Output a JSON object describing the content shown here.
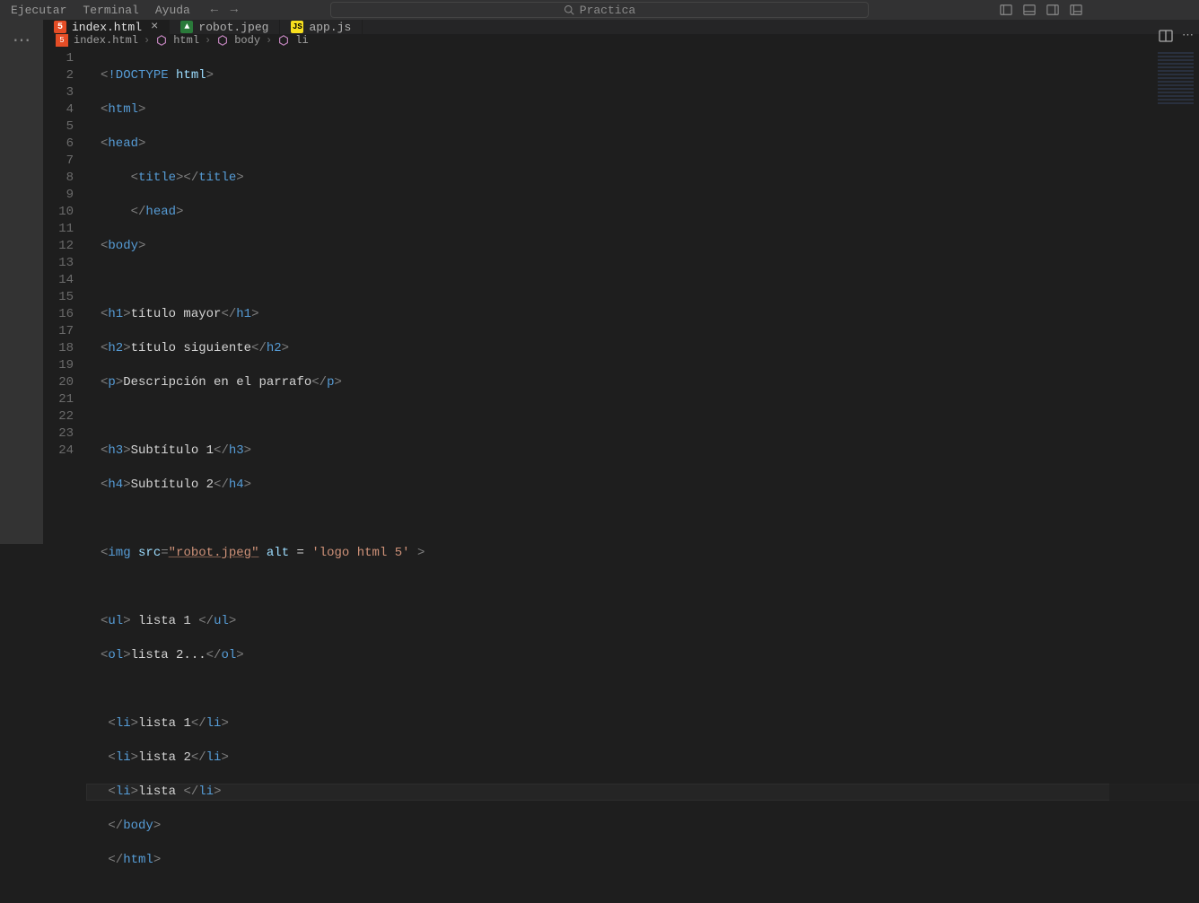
{
  "menu": {
    "run": "Ejecutar",
    "terminal": "Terminal",
    "help": "Ayuda"
  },
  "search": {
    "placeholder": "Practica"
  },
  "tabs": [
    {
      "label": "index.html"
    },
    {
      "label": "robot.jpeg"
    },
    {
      "label": "app.js"
    }
  ],
  "breadcrumbs": {
    "file": "index.html",
    "b1": "html",
    "b2": "body",
    "b3": "li"
  },
  "code": {
    "lines": [
      {
        "n": "1"
      },
      {
        "n": "2"
      },
      {
        "n": "3"
      },
      {
        "n": "4"
      },
      {
        "n": "5"
      },
      {
        "n": "6"
      },
      {
        "n": "7"
      },
      {
        "n": "8"
      },
      {
        "n": "9"
      },
      {
        "n": "10"
      },
      {
        "n": "11"
      },
      {
        "n": "12"
      },
      {
        "n": "13"
      },
      {
        "n": "14"
      },
      {
        "n": "15"
      },
      {
        "n": "16"
      },
      {
        "n": "17"
      },
      {
        "n": "18"
      },
      {
        "n": "19"
      },
      {
        "n": "20"
      },
      {
        "n": "21"
      },
      {
        "n": "22"
      },
      {
        "n": "23"
      },
      {
        "n": "24"
      }
    ],
    "l1": {
      "doctype": "!DOCTYPE",
      "html": "html"
    },
    "l2": {
      "tag": "html"
    },
    "l3": {
      "tag": "head"
    },
    "l4": {
      "tag": "title"
    },
    "l5": {
      "tag": "head"
    },
    "l6": {
      "tag": "body"
    },
    "l8": {
      "tag": "h1",
      "text": "título mayor"
    },
    "l9": {
      "tag": "h2",
      "text": "título siguiente"
    },
    "l10": {
      "tag": "p",
      "text": "Descripción en el parrafo"
    },
    "l12": {
      "tag": "h3",
      "text": "Subtítulo 1"
    },
    "l13": {
      "tag": "h4",
      "text": "Subtítulo 2"
    },
    "l15": {
      "tag": "img",
      "src_attr": "src",
      "src_val": "\"robot.jpeg\"",
      "alt_attr": "alt",
      "eq": " = ",
      "alt_val": "'logo html 5'"
    },
    "l17": {
      "tag": "ul",
      "text": " lista 1 "
    },
    "l18": {
      "tag": "ol",
      "text": "lista 2..."
    },
    "l20": {
      "tag": "li",
      "text": "lista 1"
    },
    "l21": {
      "tag": "li",
      "text": "lista 2"
    },
    "l22": {
      "tag": "li",
      "text": "lista "
    },
    "l23": {
      "tag": "body"
    },
    "l24": {
      "tag": "html"
    }
  }
}
